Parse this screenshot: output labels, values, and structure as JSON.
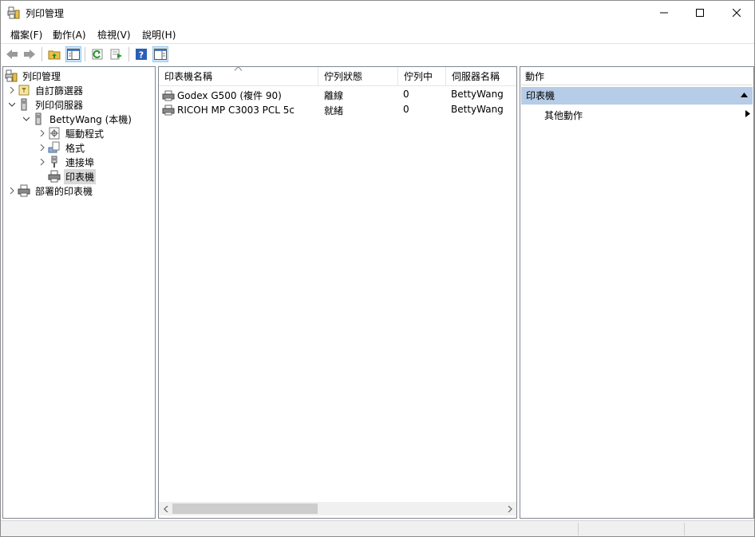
{
  "window": {
    "title": "列印管理"
  },
  "menubar": {
    "items": [
      {
        "label": "檔案(F)"
      },
      {
        "label": "動作(A)"
      },
      {
        "label": "檢視(V)"
      },
      {
        "label": "說明(H)"
      }
    ]
  },
  "tree": {
    "root": "列印管理",
    "custom_filters": "自訂篩選器",
    "print_servers": "列印伺服器",
    "server": "BettyWang (本機)",
    "drivers": "驅動程式",
    "forms": "格式",
    "ports": "連接埠",
    "printers": "印表機",
    "deployed_printers": "部署的印表機"
  },
  "list": {
    "columns": [
      "印表機名稱",
      "佇列狀態",
      "佇列中",
      "伺服器名稱"
    ],
    "rows": [
      {
        "name": "Godex G500 (複件 90)",
        "status": "離線",
        "queued": "0",
        "server": "BettyWang ("
      },
      {
        "name": "RICOH MP C3003 PCL 5c",
        "status": "就緒",
        "queued": "0",
        "server": "BettyWang ("
      }
    ]
  },
  "actions": {
    "header": "動作",
    "section": "印表機",
    "more_actions": "其他動作"
  },
  "colors": {
    "selection": "#b6cce7",
    "tree_selected": "#d9d9d9",
    "pane_border": "#828790"
  }
}
